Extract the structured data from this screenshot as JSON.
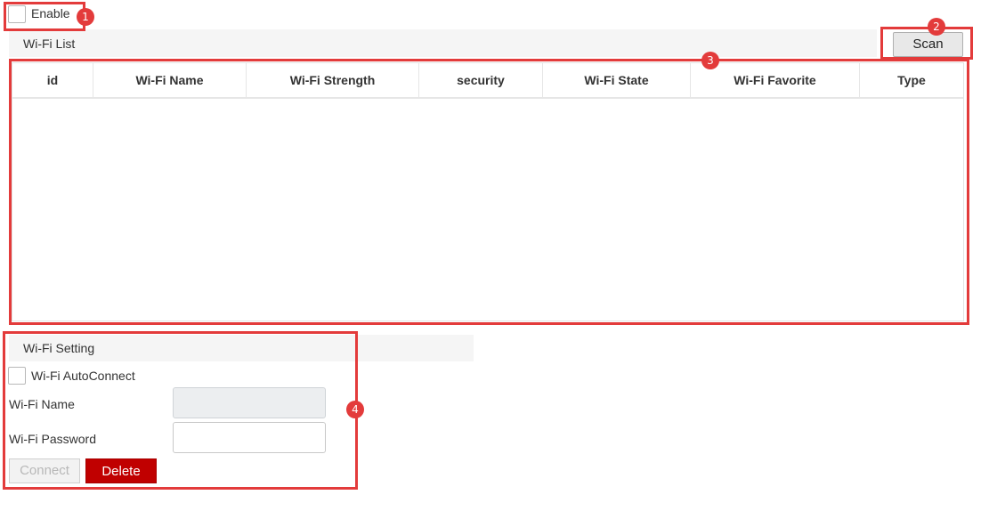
{
  "enable": {
    "label": "Enable",
    "checked": false
  },
  "wifi_list": {
    "title": "Wi-Fi List",
    "scan_label": "Scan",
    "columns": [
      "id",
      "Wi-Fi Name",
      "Wi-Fi Strength",
      "security",
      "Wi-Fi State",
      "Wi-Fi Favorite",
      "Type"
    ],
    "rows": []
  },
  "wifi_setting": {
    "title": "Wi-Fi Setting",
    "autoconnect_label": "Wi-Fi AutoConnect",
    "autoconnect_checked": false,
    "name_label": "Wi-Fi Name",
    "name_value": "",
    "password_label": "Wi-Fi Password",
    "password_value": "",
    "connect_label": "Connect",
    "delete_label": "Delete"
  },
  "annotations": [
    "1",
    "2",
    "3",
    "4"
  ],
  "colors": {
    "annotation": "#e33b3b",
    "delete_button": "#c00000"
  }
}
